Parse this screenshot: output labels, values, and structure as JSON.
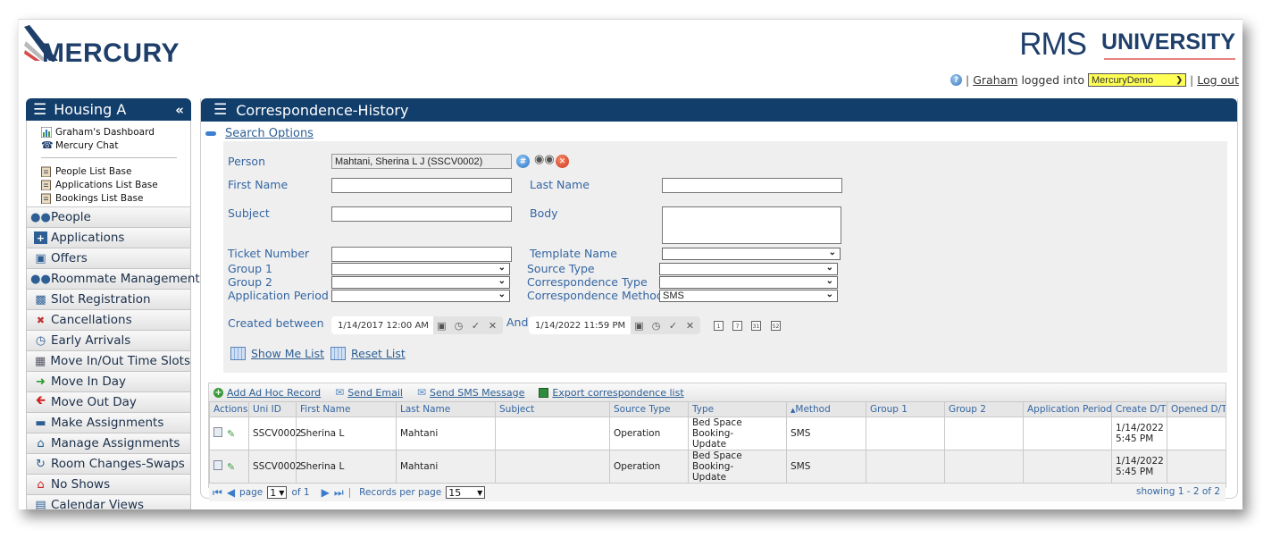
{
  "brand": {
    "logo": "MERCURY",
    "rms": "RMS",
    "university": "UNIVERSITY"
  },
  "userbar": {
    "help_icon": "help-icon",
    "user": "Graham",
    "logged_into": "logged into",
    "database": "MercuryDemo",
    "logout": "Log out"
  },
  "sidebar": {
    "title": "Housing A",
    "quick_links": [
      {
        "label": "Graham's Dashboard",
        "icon": "chart-icon"
      },
      {
        "label": "Mercury Chat",
        "icon": "phone-icon"
      }
    ],
    "list_bases": [
      {
        "label": "People List Base",
        "icon": "clipboard-icon"
      },
      {
        "label": "Applications List Base",
        "icon": "clipboard-icon"
      },
      {
        "label": "Bookings List Base",
        "icon": "clipboard-icon"
      }
    ],
    "items": [
      {
        "label": "People",
        "icon": "people-icon"
      },
      {
        "label": "Applications",
        "icon": "add-document-icon"
      },
      {
        "label": "Offers",
        "icon": "folder-add-icon"
      },
      {
        "label": "Roommate Management",
        "icon": "people-icon"
      },
      {
        "label": "Slot Registration",
        "icon": "registration-icon"
      },
      {
        "label": "Cancellations",
        "icon": "cancel-document-icon"
      },
      {
        "label": "Early Arrivals",
        "icon": "clock-icon"
      },
      {
        "label": "Move In/Out Time Slots",
        "icon": "calendar-grid-icon"
      },
      {
        "label": "Move In Day",
        "icon": "arrow-right-icon"
      },
      {
        "label": "Move Out Day",
        "icon": "arrow-left-icon"
      },
      {
        "label": "Make Assignments",
        "icon": "bed-icon"
      },
      {
        "label": "Manage Assignments",
        "icon": "home-icon"
      },
      {
        "label": "Room Changes-Swaps",
        "icon": "swap-icon"
      },
      {
        "label": "No Shows",
        "icon": "home-red-icon"
      },
      {
        "label": "Calendar Views",
        "icon": "calendar-icon"
      }
    ]
  },
  "main": {
    "title": "Correspondence-History",
    "search_options": "Search Options",
    "form": {
      "person_label": "Person",
      "person_value": "Mahtani, Sherina L J (SSCV0002)",
      "first_name_label": "First Name",
      "first_name_value": "",
      "last_name_label": "Last Name",
      "last_name_value": "",
      "subject_label": "Subject",
      "subject_value": "",
      "body_label": "Body",
      "body_value": "",
      "ticket_label": "Ticket Number",
      "ticket_value": "",
      "template_label": "Template Name",
      "template_value": "",
      "group1_label": "Group 1",
      "group1_value": "",
      "group2_label": "Group 2",
      "group2_value": "",
      "app_period_label": "Application Period",
      "app_period_value": "",
      "source_type_label": "Source Type",
      "source_type_value": "",
      "corr_type_label": "Correspondence Type",
      "corr_type_value": "",
      "corr_method_label": "Correspondence Method",
      "corr_method_value": "SMS",
      "created_between_label": "Created between",
      "created_from": "1/14/2017 12:00 AM",
      "and_label": "And",
      "created_to": "1/14/2022 11:59 PM",
      "quick_dates": [
        "1",
        "7",
        "31",
        "52"
      ],
      "show_me_list": "Show Me List",
      "reset_list": "Reset List"
    },
    "toolbar": {
      "add_ad_hoc": "Add Ad Hoc Record",
      "send_email": "Send Email",
      "send_sms": "Send SMS Message",
      "export": "Export correspondence list"
    },
    "table": {
      "columns": [
        "Actions",
        "Uni ID",
        "First Name",
        "Last Name",
        "Subject",
        "Source Type",
        "Type",
        "Method",
        "Group 1",
        "Group 2",
        "Application Period",
        "Create D/T",
        "Opened D/T"
      ],
      "sort_column": "Method",
      "rows": [
        {
          "uni_id": "SSCV0002",
          "first_name": "Sherina L",
          "last_name": "Mahtani",
          "subject": "",
          "source_type": "Operation",
          "type_line1": "Bed Space Booking-",
          "type_line2": "Update",
          "method": "SMS",
          "group1": "",
          "group2": "",
          "app_period": "",
          "create_date": "1/14/2022",
          "create_time": "5:45 PM",
          "opened": ""
        },
        {
          "uni_id": "SSCV0002",
          "first_name": "Sherina L",
          "last_name": "Mahtani",
          "subject": "",
          "source_type": "Operation",
          "type_line1": "Bed Space Booking-",
          "type_line2": "Update",
          "method": "SMS",
          "group1": "",
          "group2": "",
          "app_period": "",
          "create_date": "1/14/2022",
          "create_time": "5:45 PM",
          "opened": ""
        }
      ]
    },
    "pager": {
      "page_label": "page",
      "page": "1",
      "of_label": "of 1",
      "records_label": "Records per page",
      "records_per_page": "15",
      "showing": "showing 1 - 2 of 2"
    }
  },
  "colors": {
    "header_navy": "#123e6c",
    "link_blue": "#2d5f94",
    "label_blue": "#3466a3",
    "db_select_yellow": "#ffff55"
  }
}
